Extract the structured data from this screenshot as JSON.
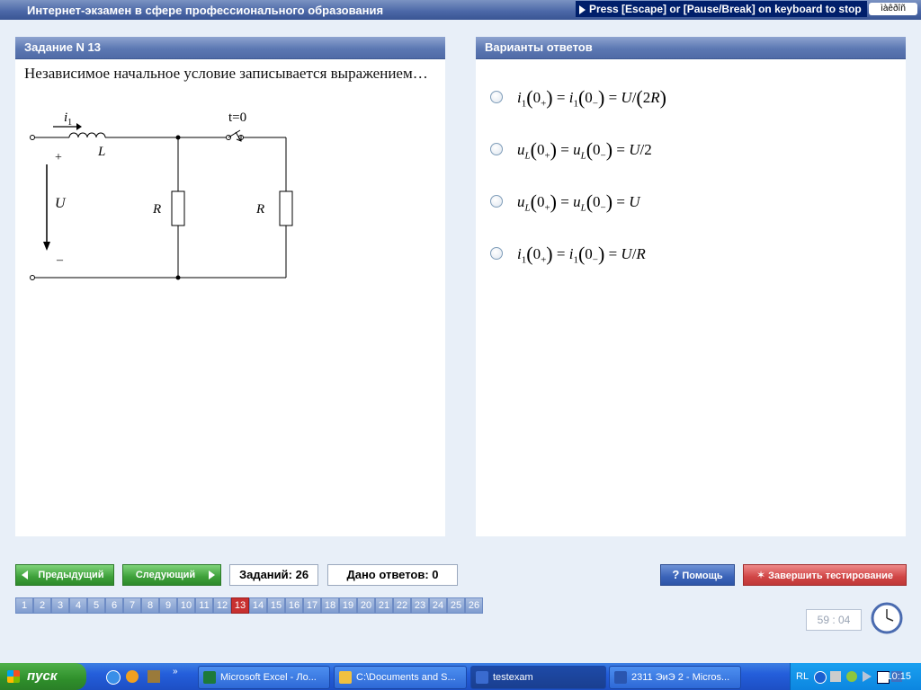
{
  "window": {
    "title": "Интернет-экзамен в сфере профессионального образования",
    "escape_hint": "Press [Escape] or [Pause/Break] on keyboard to stop",
    "lang": "ìàêðîñ"
  },
  "question": {
    "header": "Задание N 13",
    "text": "Независимое начальное условие записывается выражением…",
    "circuit_labels": {
      "current": "i",
      "current_sub": "1",
      "switch": "t=0",
      "inductor": "L",
      "plus": "+",
      "minus": "–",
      "voltage": "U",
      "r1": "R",
      "r2": "R"
    }
  },
  "answers": {
    "header": "Варианты ответов",
    "options": [
      {
        "formula_html": "<i>i</i><sub>1</sub><span class=\"big\">(</span>0<sub>+</sub><span class=\"big\">)</span> = <i>i</i><sub>1</sub><span class=\"big\">(</span>0<sub>−</sub><span class=\"big\">)</span> = <i>U</i>/<span class=\"big\">(</span>2<i>R</i><span class=\"big\">)</span>"
      },
      {
        "formula_html": "<i>u</i><sub><i>L</i></sub><span class=\"big\">(</span>0<sub>+</sub><span class=\"big\">)</span> = <i>u</i><sub><i>L</i></sub><span class=\"big\">(</span>0<sub>−</sub><span class=\"big\">)</span> = <i>U</i>/2"
      },
      {
        "formula_html": "<i>u</i><sub><i>L</i></sub><span class=\"big\">(</span>0<sub>+</sub><span class=\"big\">)</span> = <i>u</i><sub><i>L</i></sub><span class=\"big\">(</span>0<sub>−</sub><span class=\"big\">)</span> = <i>U</i>"
      },
      {
        "formula_html": "<i>i</i><sub>1</sub><span class=\"big\">(</span>0<sub>+</sub><span class=\"big\">)</span> = <i>i</i><sub>1</sub><span class=\"big\">(</span>0<sub>−</sub><span class=\"big\">)</span> = <i>U</i>/<i>R</i>"
      }
    ]
  },
  "nav": {
    "prev_label": "Предыдущий",
    "next_label": "Следующий",
    "tasks_count": "Заданий: 26",
    "answers_count": "Дано ответов: 0",
    "help_label": "Помощь",
    "finish_label": "Завершить тестирование",
    "timer": "59 : 04"
  },
  "pager": {
    "pages": [
      "1",
      "2",
      "3",
      "4",
      "5",
      "6",
      "7",
      "8",
      "9",
      "10",
      "11",
      "12",
      "13",
      "14",
      "15",
      "16",
      "17",
      "18",
      "19",
      "20",
      "21",
      "22",
      "23",
      "24",
      "25",
      "26"
    ],
    "active": "13"
  },
  "taskbar": {
    "start_label": "пуск",
    "items": [
      {
        "label": "Microsoft Excel - Ло...",
        "icon": "excel-icon"
      },
      {
        "label": "C:\\Documents and S...",
        "icon": "folder-icon"
      },
      {
        "label": "testexam",
        "icon": "app-icon",
        "active": true
      },
      {
        "label": "2311 ЭиЭ 2 - Micros...",
        "icon": "word-icon"
      }
    ],
    "tray_lang": "RL",
    "time": "10:15"
  },
  "colors": {
    "panel_header": "#5c78b3",
    "active_page": "#c83030",
    "green_btn": "#3ea03a",
    "red_btn": "#d04545",
    "blue_btn": "#3a63b8"
  }
}
